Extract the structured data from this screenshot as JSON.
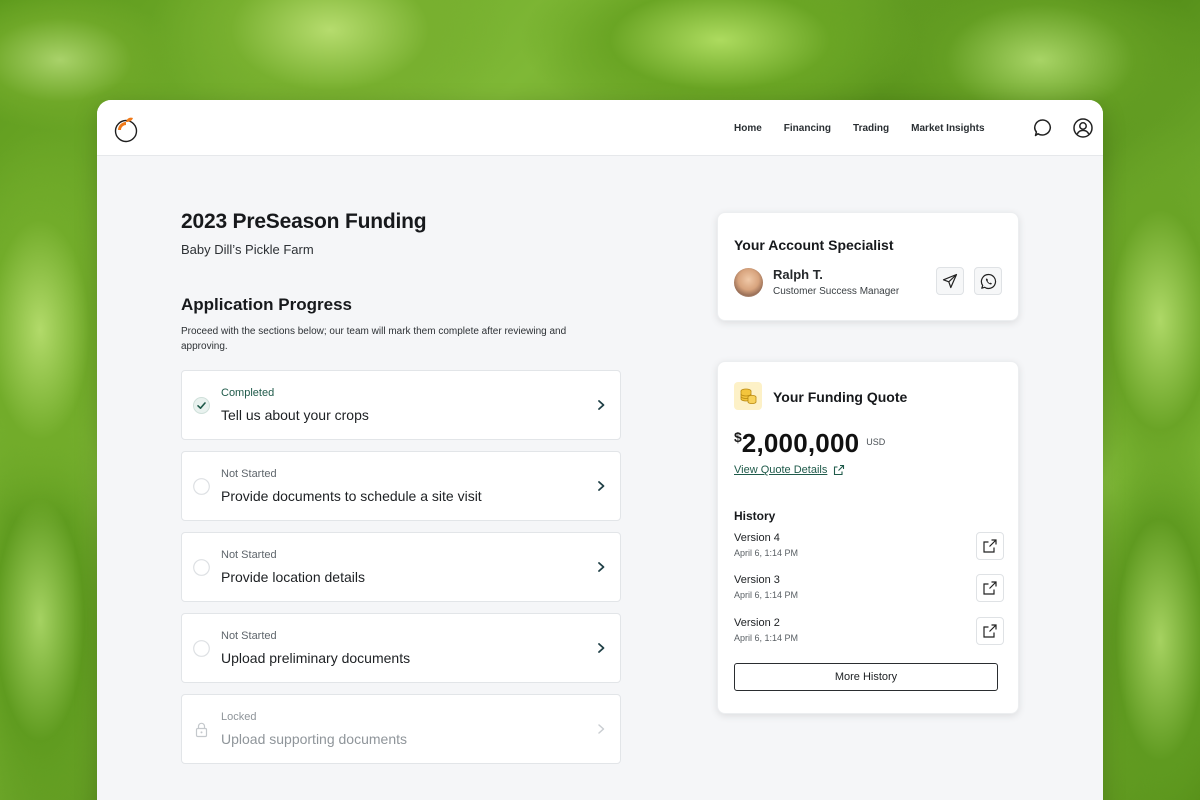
{
  "nav": {
    "items": [
      "Home",
      "Financing",
      "Trading",
      "Market Insights"
    ],
    "icons": [
      "chat-icon",
      "account-icon"
    ]
  },
  "page": {
    "title": "2023 PreSeason Funding",
    "subtitle": "Baby Dill’s Pickle Farm"
  },
  "progress": {
    "title": "Application Progress",
    "description": "Proceed with the sections below; our team will mark them complete after reviewing and approving.",
    "steps": [
      {
        "status": "Completed",
        "label": "Tell us about your crops",
        "state": "completed"
      },
      {
        "status": "Not Started",
        "label": "Provide documents to schedule a site visit",
        "state": "not-started"
      },
      {
        "status": "Not Started",
        "label": "Provide location details",
        "state": "not-started"
      },
      {
        "status": "Not Started",
        "label": "Upload preliminary documents",
        "state": "not-started"
      },
      {
        "status": "Locked",
        "label": "Upload supporting documents",
        "state": "locked"
      }
    ]
  },
  "specialist": {
    "title": "Your Account Specialist",
    "name": "Ralph T.",
    "role": "Customer Success Manager"
  },
  "quote": {
    "title": "Your Funding Quote",
    "currency_symbol": "$",
    "amount": "2,000,000",
    "unit": "USD",
    "link_label": "View Quote Details",
    "history_title": "History",
    "history": [
      {
        "version": "Version 4",
        "date": "April 6, 1:14 PM"
      },
      {
        "version": "Version 3",
        "date": "April 6, 1:14 PM"
      },
      {
        "version": "Version 2",
        "date": "April 6, 1:14 PM"
      }
    ],
    "more_label": "More History"
  },
  "colors": {
    "accent": "#1f5a4a",
    "logo_orange": "#f07a1a",
    "coin_bg": "#fdf1c7"
  }
}
